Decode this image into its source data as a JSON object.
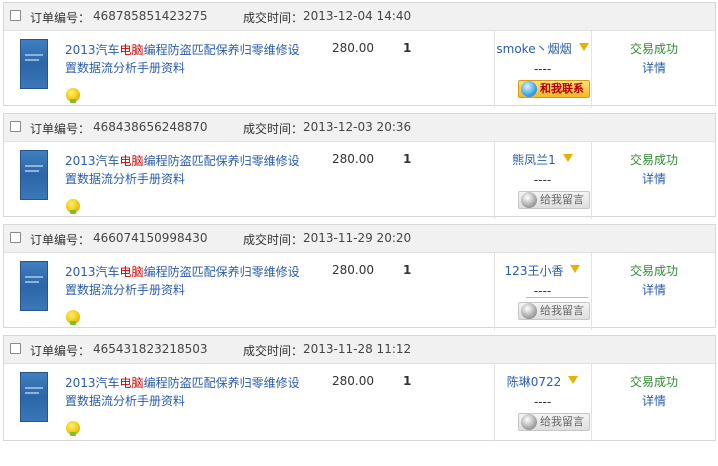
{
  "labels": {
    "order_no": "订单编号：",
    "deal_time": "成交时间：",
    "contact": "和我联系",
    "leave_msg": "给我留言"
  },
  "orders": [
    {
      "order_no": "468785851423275",
      "time": "2013-12-04 14:40",
      "title_pre": "2013汽车",
      "title_hl": "电脑",
      "title_post": "编程防盗匹配保养归零维修设置数据流分析手册资料",
      "price": "280.00",
      "qty": "1",
      "buyer": "smoke丶烟烟",
      "dash": "----",
      "status": "交易成功",
      "detail": "详情"
    },
    {
      "order_no": "468438656248870",
      "time": "2013-12-03 20:36",
      "title_pre": "2013汽车",
      "title_hl": "电脑",
      "title_post": "编程防盗匹配保养归零维修设置数据流分析手册资料",
      "price": "280.00",
      "qty": "1",
      "buyer": "熊凤兰1",
      "dash": "----",
      "status": "交易成功",
      "detail": "详情"
    },
    {
      "order_no": "466074150998430",
      "time": "2013-11-29 20:20",
      "title_pre": "2013汽车",
      "title_hl": "电脑",
      "title_post": "编程防盗匹配保养归零维修设置数据流分析手册资料",
      "price": "280.00",
      "qty": "1",
      "buyer": "123王小香",
      "dash": "----",
      "status": "交易成功",
      "detail": "详情"
    },
    {
      "order_no": "465431823218503",
      "time": "2013-11-28 11:12",
      "title_pre": "2013汽车",
      "title_hl": "电脑",
      "title_post": "编程防盗匹配保养归零维修设置数据流分析手册资料",
      "price": "280.00",
      "qty": "1",
      "buyer": "陈琳0722",
      "dash": "----",
      "status": "交易成功",
      "detail": "详情"
    }
  ],
  "icons": {
    "checkbox": "checkbox-icon",
    "product": "product-thumbnail-icon",
    "bulb": "lightbulb-icon",
    "filter": "funnel-icon",
    "chat": "chat-bubble-icon"
  },
  "colors": {
    "link": "#2b5cae",
    "highlight": "#d40000",
    "success": "#2f8a2f",
    "header_bg": "#f1f1f1"
  }
}
